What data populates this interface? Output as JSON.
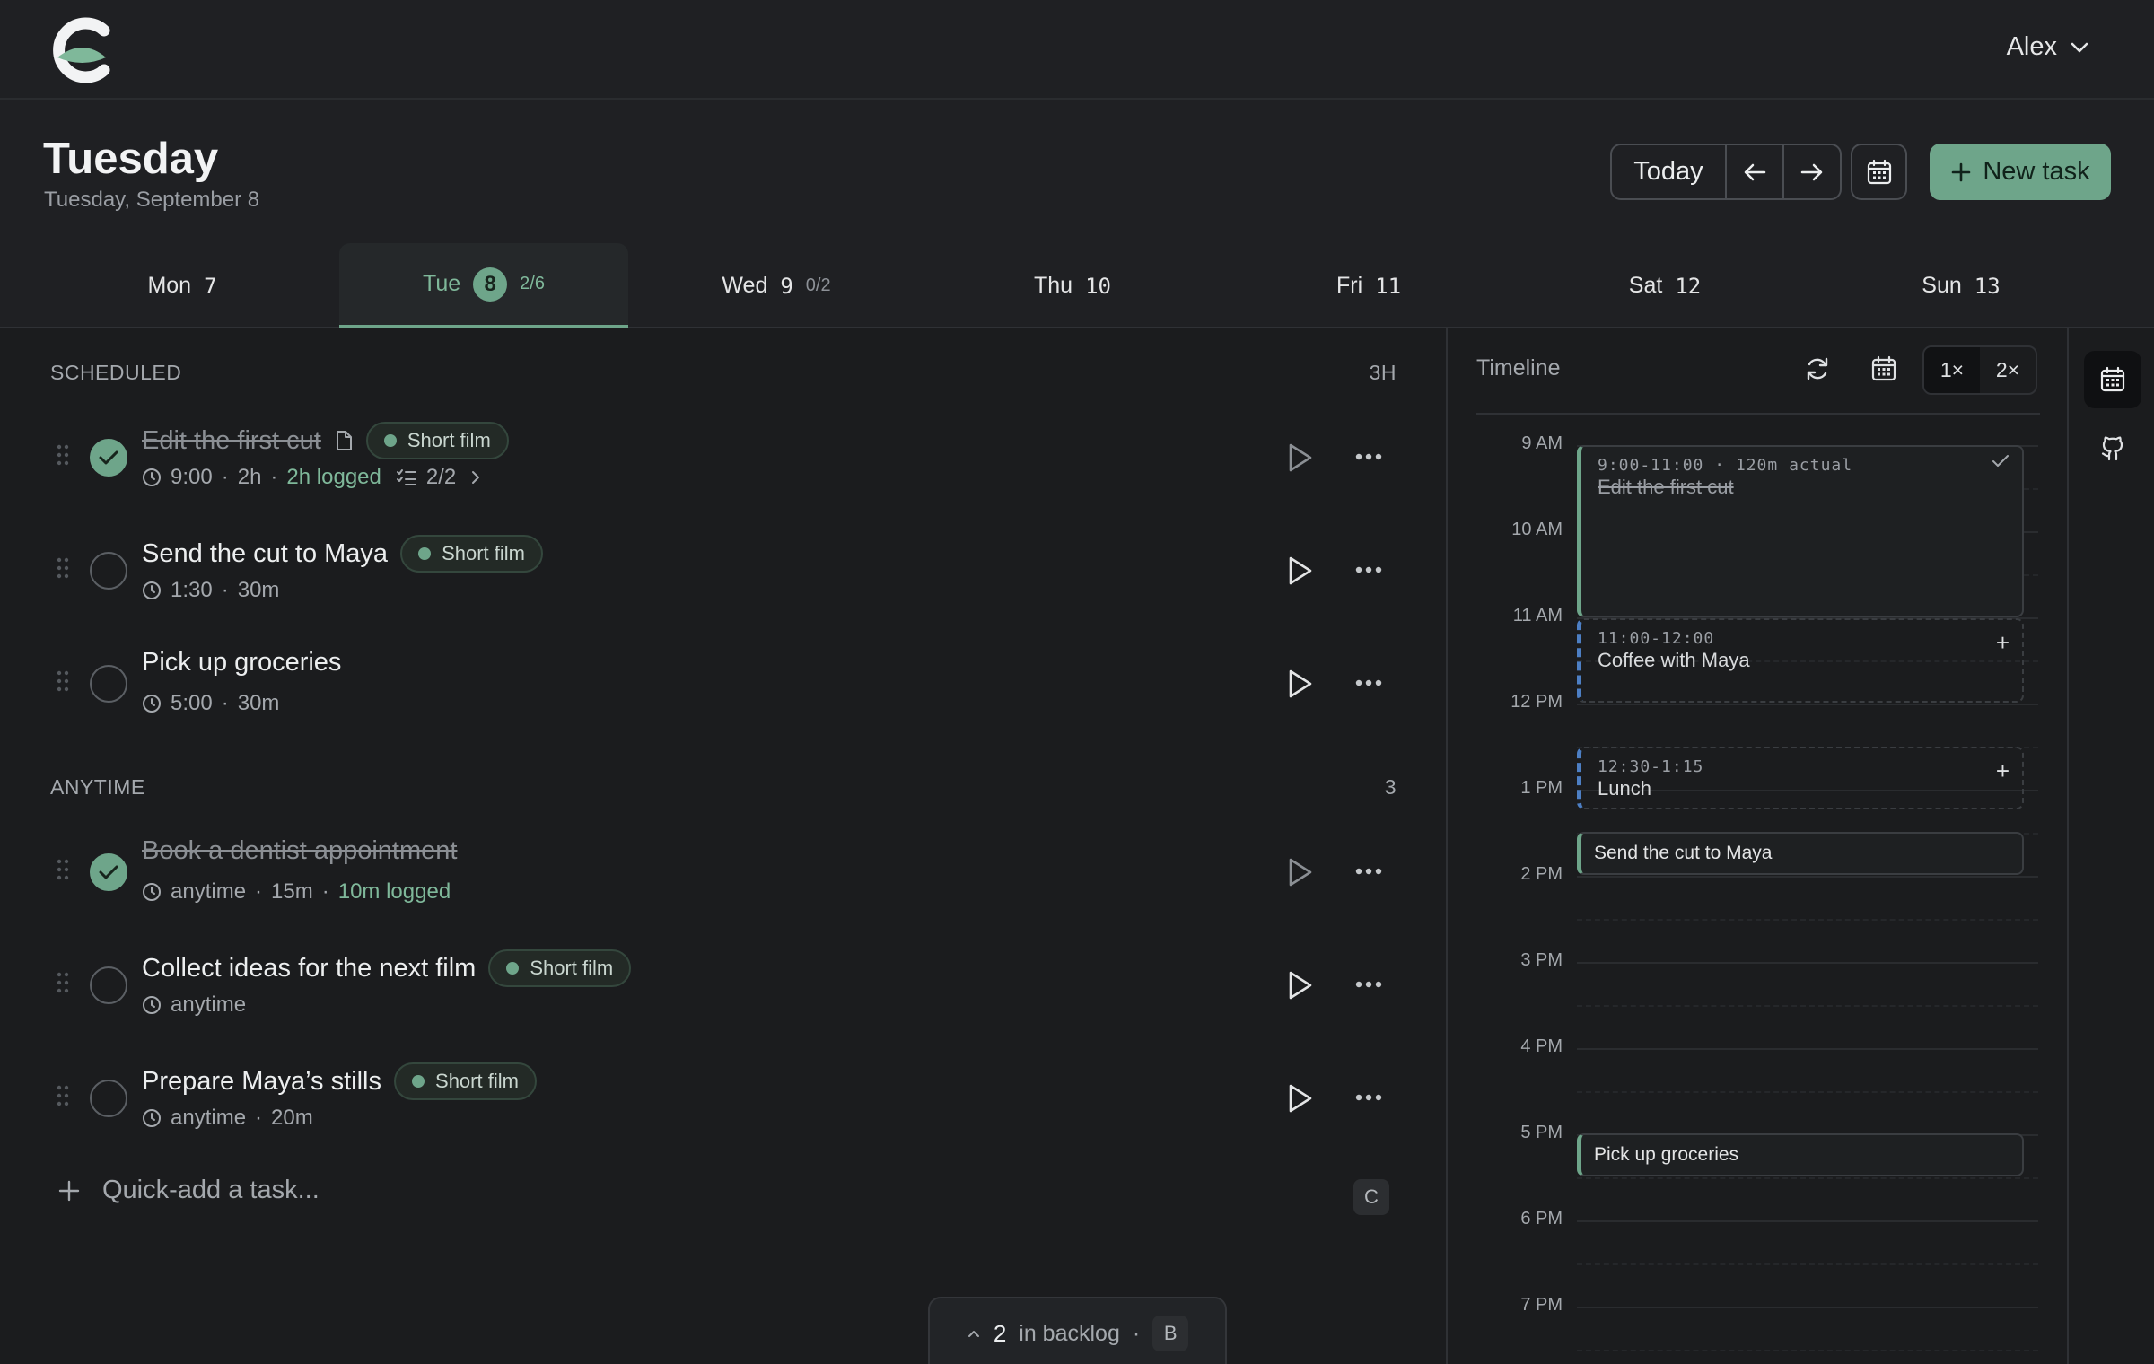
{
  "user": {
    "name": "Alex"
  },
  "header": {
    "title": "Tuesday",
    "subtitle": "Tuesday, September 8",
    "today_label": "Today",
    "new_task_label": "New task"
  },
  "days": [
    {
      "name": "Mon",
      "num": "7",
      "progress": ""
    },
    {
      "name": "Tue",
      "num": "8",
      "progress": "2/6"
    },
    {
      "name": "Wed",
      "num": "9",
      "progress": "0/2"
    },
    {
      "name": "Thu",
      "num": "10",
      "progress": ""
    },
    {
      "name": "Fri",
      "num": "11",
      "progress": ""
    },
    {
      "name": "Sat",
      "num": "12",
      "progress": ""
    },
    {
      "name": "Sun",
      "num": "13",
      "progress": ""
    }
  ],
  "scheduled": {
    "label": "SCHEDULED",
    "total": "3H",
    "tasks": [
      {
        "title": "Edit the first cut",
        "done": true,
        "tag": "Short film",
        "time": "9:00",
        "duration": "2h",
        "logged": "2h logged",
        "subtasks": "2/2"
      },
      {
        "title": "Send the cut to Maya",
        "done": false,
        "tag": "Short film",
        "time": "1:30",
        "duration": "30m"
      },
      {
        "title": "Pick up groceries",
        "done": false,
        "tag": "",
        "time": "5:00",
        "duration": "30m"
      }
    ]
  },
  "anytime": {
    "label": "ANYTIME",
    "total": "3",
    "tasks": [
      {
        "title": "Book a dentist appointment",
        "done": true,
        "time": "anytime",
        "duration": "15m",
        "logged": "10m logged"
      },
      {
        "title": "Collect ideas for the next film",
        "done": false,
        "tag": "Short film",
        "time": "anytime"
      },
      {
        "title": "Prepare Maya’s stills",
        "done": false,
        "tag": "Short film",
        "time": "anytime",
        "duration": "20m"
      }
    ]
  },
  "quickadd": {
    "placeholder": "Quick-add a task...",
    "shortcut": "C"
  },
  "backlog": {
    "count": "2",
    "label": "in backlog",
    "shortcut": "B"
  },
  "timeline": {
    "title": "Timeline",
    "zoom": [
      "1×",
      "2×"
    ],
    "zoom_selected": "1×",
    "hours": [
      "9 AM",
      "10 AM",
      "11 AM",
      "12 PM",
      "1 PM",
      "2 PM",
      "3 PM",
      "4 PM",
      "5 PM",
      "6 PM",
      "7 PM"
    ],
    "events": [
      {
        "time": "9:00-11:00 · 120m actual",
        "name": "Edit the first cut"
      },
      {
        "time": "11:00-12:00",
        "name": "Coffee with Maya"
      },
      {
        "time": "12:30-1:15",
        "name": "Lunch"
      },
      {
        "name": "Send the cut to Maya"
      },
      {
        "name": "Pick up groceries"
      }
    ]
  },
  "colors": {
    "accent": "#6ea58a",
    "background": "#1b1c1e",
    "external_event": "#4d7fc4"
  }
}
